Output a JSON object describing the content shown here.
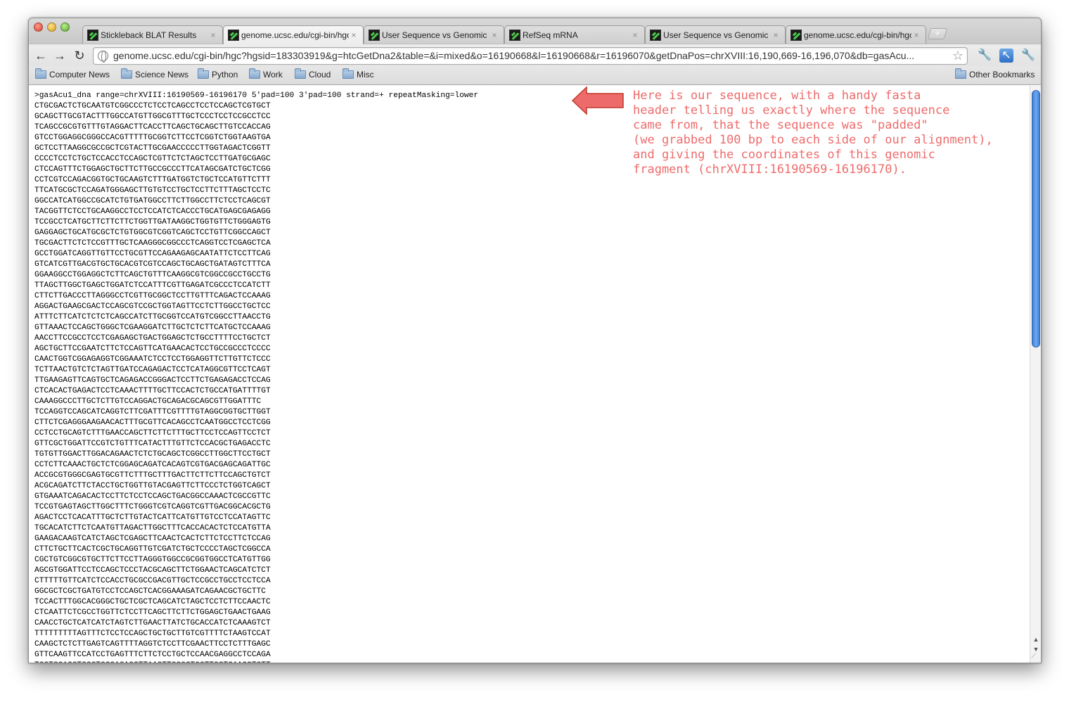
{
  "tabs": [
    {
      "title": "Stickleback BLAT Results",
      "active": false
    },
    {
      "title": "genome.ucsc.edu/cgi-bin/hgc",
      "active": true
    },
    {
      "title": "User Sequence vs Genomic",
      "active": false
    },
    {
      "title": "RefSeq mRNA",
      "active": false
    },
    {
      "title": "User Sequence vs Genomic",
      "active": false
    },
    {
      "title": "genome.ucsc.edu/cgi-bin/hgc",
      "active": false
    }
  ],
  "tab_close_glyph": "×",
  "new_tab_glyph": "+",
  "toolbar": {
    "back": "←",
    "forward": "→",
    "reload": "↻",
    "url": "genome.ucsc.edu/cgi-bin/hgc?hgsid=183303919&g=htcGetDna2&table=&i=mixed&o=16190668&l=16190668&r=16196070&getDnaPos=chrXVIII:16,190,669-16,196,070&db=gasAcu...",
    "star": "☆",
    "page_icon": "🔧",
    "ext_icon": "↖",
    "wrench_icon": "🔧"
  },
  "bookmarks": [
    "Computer News",
    "Science News",
    "Python",
    "Work",
    "Cloud",
    "Misc"
  ],
  "other_bookmarks": "Other Bookmarks",
  "fasta_header": ">gasAcu1_dna range=chrXVIII:16190569-16196170 5'pad=100 3'pad=100 strand=+ repeatMasking=lower",
  "sequence_lines": [
    "CTGCGACTCTGCAATGTCGGCCCTCTCCTCAGCCTCCTCCAGCTCGTGCT",
    "GCAGCTTGCGTACTTTGGCCATGTTGGCGTTTGCTCCCTCCTCCGCCTCC",
    "TCAGCCGCGTGTTTGTAGGACTTCACCTTCAGCTGCAGCTTGTCCACCAG",
    "GTCCTGGAGGCGGGCCACGTTTTTGCGGTCTTCCTCGGTCTGGTAAGTGA",
    "GCTCCTTAAGGCGCCGCTCGTACTTGCGAACCCCCTTGGTAGACTCGGTT",
    "CCCCTCCTCTGCTCCACCTCCAGCTCGTTCTCTAGCTCCTTGATGCGAGC",
    "CTCCAGTTTCTGGAGCTGCTTCTTGCCGCCCTTCATAGCGATCTGCTCGG",
    "CCTCGTCCAGACGGTGCTGCAAGTCTTTGATGGTCTGCTCCATGTTCTTT",
    "TTCATGCGCTCCAGATGGGAGCTTGTGTCCTGCTCCTTCTTTAGCTCCTC",
    "GGCCATCATGGCCGCATCTGTGATGGCCTTCTTGGCCTTCTCCTCAGCGT",
    "TACGGTTCTCCTGCAAGGCCTCCTCCATCTCACCCTGCATGAGCGAGAGG",
    "TCCGCCTCATGCTTCTTCTTCTGGTTGATAAGGCTGGTGTTCTGGGAGTG",
    "GAGGAGCTGCATGCGCTCTGTGGCGTCGGTCAGCTCCTGTTCGGCCAGCT",
    "TGCGACTTCTCTCCGTTTGCTCAAGGGCGGCCCTCAGGTCCTCGAGCTCA",
    "GCCTGGATCAGGTTGTTCCTGCGTTCCAGAAGAGCAATATTCTCCTTCAG",
    "GTCATCGTTGACGTGCTGCACGTCGTCCAGCTGCAGCTGATAGTCTTTCA",
    "GGAAGGCCTGGAGGCTCTTCAGCTGTTTCAAGGCGTCGGCCGCCTGCCTG",
    "TTAGCTTGGCTGAGCTGGATCTCCATTTCGTTGAGATCGCCCTCCATCTT",
    "CTTCTTGACCCTTAGGGCCTCGTTGCGGCTCCTTGTTTCAGACTCCAAAG",
    "AGGACTGAAGCGACTCCAGCGTCCGCTGGTAGTTCCTCTTGGCCTGCTCC",
    "ATTTCTTCATCTCTCTCAGCCATCTTGCGGTCCATGTCGGCCTTAACCTG",
    "GTTAAACTCCAGCTGGGCTCGAAGGATCTTGCTCTCTTCATGCTCCAAAG",
    "AACCTTCCGCCTCCTCGAGAGCTGACTGGAGCTCTGCCTTTTCCTGCTCT",
    "AGCTGCTTCCGAATCTTCTCCAGTTCATGAACACTCCTGCCGCCCTCCCC",
    "CAACTGGTCGGAGAGGTCGGAAATCTCCTCCTGGAGGTTCTTGTTCTCCC",
    "TCTTAACTGTCTCTAGTTGATCCAGAGACTCCTCATAGGCGTTCCTCAGT",
    "TTGAAGAGTTCAGTGCTCAGAGACCGGGACTCCTTCTGAGAGACCTCCAG",
    "CTCACACTGAGACTCCTCAAACTTTTGCTTCCACTCTGCCATGATTTTGT",
    "CAAAGGCCCTTGCTCTTGTCCAGGACTGCAGACGCAGCGTTGGATTTC",
    "TCCAGGTCCAGCATCAGGTCTTCGATTTCGTTTTGTAGGCGGTGCTTGGT",
    "CTTCTCGAGGGAAGAACACTTTGCGTTCACAGCCTCAATGGCCTCCTCGG",
    "CCTCCTGCAGTCTTTGAACCAGCTTCTTCTTTGCTTCCTCCAGTTCCTCT",
    "GTTCGCTGGATTCCGTCTGTTTCATACTTTGTTCTCCACGCTGAGACCTC",
    "TGTGTTGGACTTGGACAGAACTCTCTGCAGCTCGGCCTTGGCTTCCTGCT",
    "CCTCTTCAAACTGCTCTCGGAGCAGATCACAGTCGTGACGAGCAGATTGC",
    "ACCGCGTGGGCGAGTGCGTTCTTTGCTTTGACTTCTTCTTCCAGCTGTCT",
    "ACGCAGATCTTCTACCTGCTGGTTGTACGAGTTCTTCCCTCTGGTCAGCT",
    "GTGAAATCAGACACTCCTTCTCCTCCAGCTGACGGCCAAACTCGCCGTTC",
    "TCCGTGAGTAGCTTGGCTTTCTGGGTCGTCAGGTCGTTGACGGCACGCTG",
    "AGACTCCTCACATTTGCTCTTGTACTCATTCATGTTGTCCTCCATAGTTC",
    "TGCACATCTTCTCAATGTTAGACTTGGCTTTCACCACACTCTCCATGTTA",
    "GAAGACAAGTCATCTAGCTCGAGCTTCAACTCACTCTTCTCCTTCTCCAG",
    "CTTCTGCTTCACTCGCTGCAGGTTGTCGATCTGCTCCCCTAGCTCGGCCA",
    "CGCTGTCGGCGTGCTTCTTCCTTAGGGTGGCCGCGGTGGCCTCATGTTGG",
    "AGCGTGGATTCCTCCAGCTCCCTACGCAGCTTCTGGAACTCAGCATCTCT",
    "CTTTTTGTTCATCTCCACCTGCGCCGACGTTGCTCCGCCTGCCTCCTCCA",
    "GGCGCTCGCTGATGTCCTCCAGCTCACGGAAAGATCAGAACGCTGCTTC",
    "TCCACTTTGGCACGGGCTGCTCGCTCAGCATCTAGCTCCTCTTCCAACTC",
    "CTCAATTCTCGCCTGGTTCTCCTTCAGCTTCTTCTGGAGCTGAACTGAAG",
    "CAACCTGCTCATCATCTAGTCTTGAACTTATCTGCACCATCTCAAAGTCT",
    "TTTTTTTTTAGTTTCTCCTCCAGCTGCTGCTTGTCGTTTTCTAAGTCCAT",
    "CAAGCTCTCTTGAGTCAGTTTTAGGTCTCCTTCGAACTTCCTCTTTGAGC",
    "GTTCAAGTTCCATCCTGAGTTTCTTCTCCTGCTCCAACGAGGCCTCCAGA",
    "TCGTCCAGGTCGCTGCCAGAGCTTAAGTTGCCCTCCTTGGTCAAGCTCTT"
  ],
  "annotation": "Here is our sequence, with a handy fasta\nheader telling us exactly where the sequence\ncame from, that the sequence was \"padded\"\n(we grabbed 100 bp to each side of our alignment),\nand giving the coordinates of this genomic\nfragment (chrXVIII:16190569-16196170).",
  "colors": {
    "annotation": "#ee6b6b",
    "arrow_fill": "#ee6b6b",
    "arrow_stroke": "#c0392b",
    "scroll_thumb": "#4a86d8"
  }
}
